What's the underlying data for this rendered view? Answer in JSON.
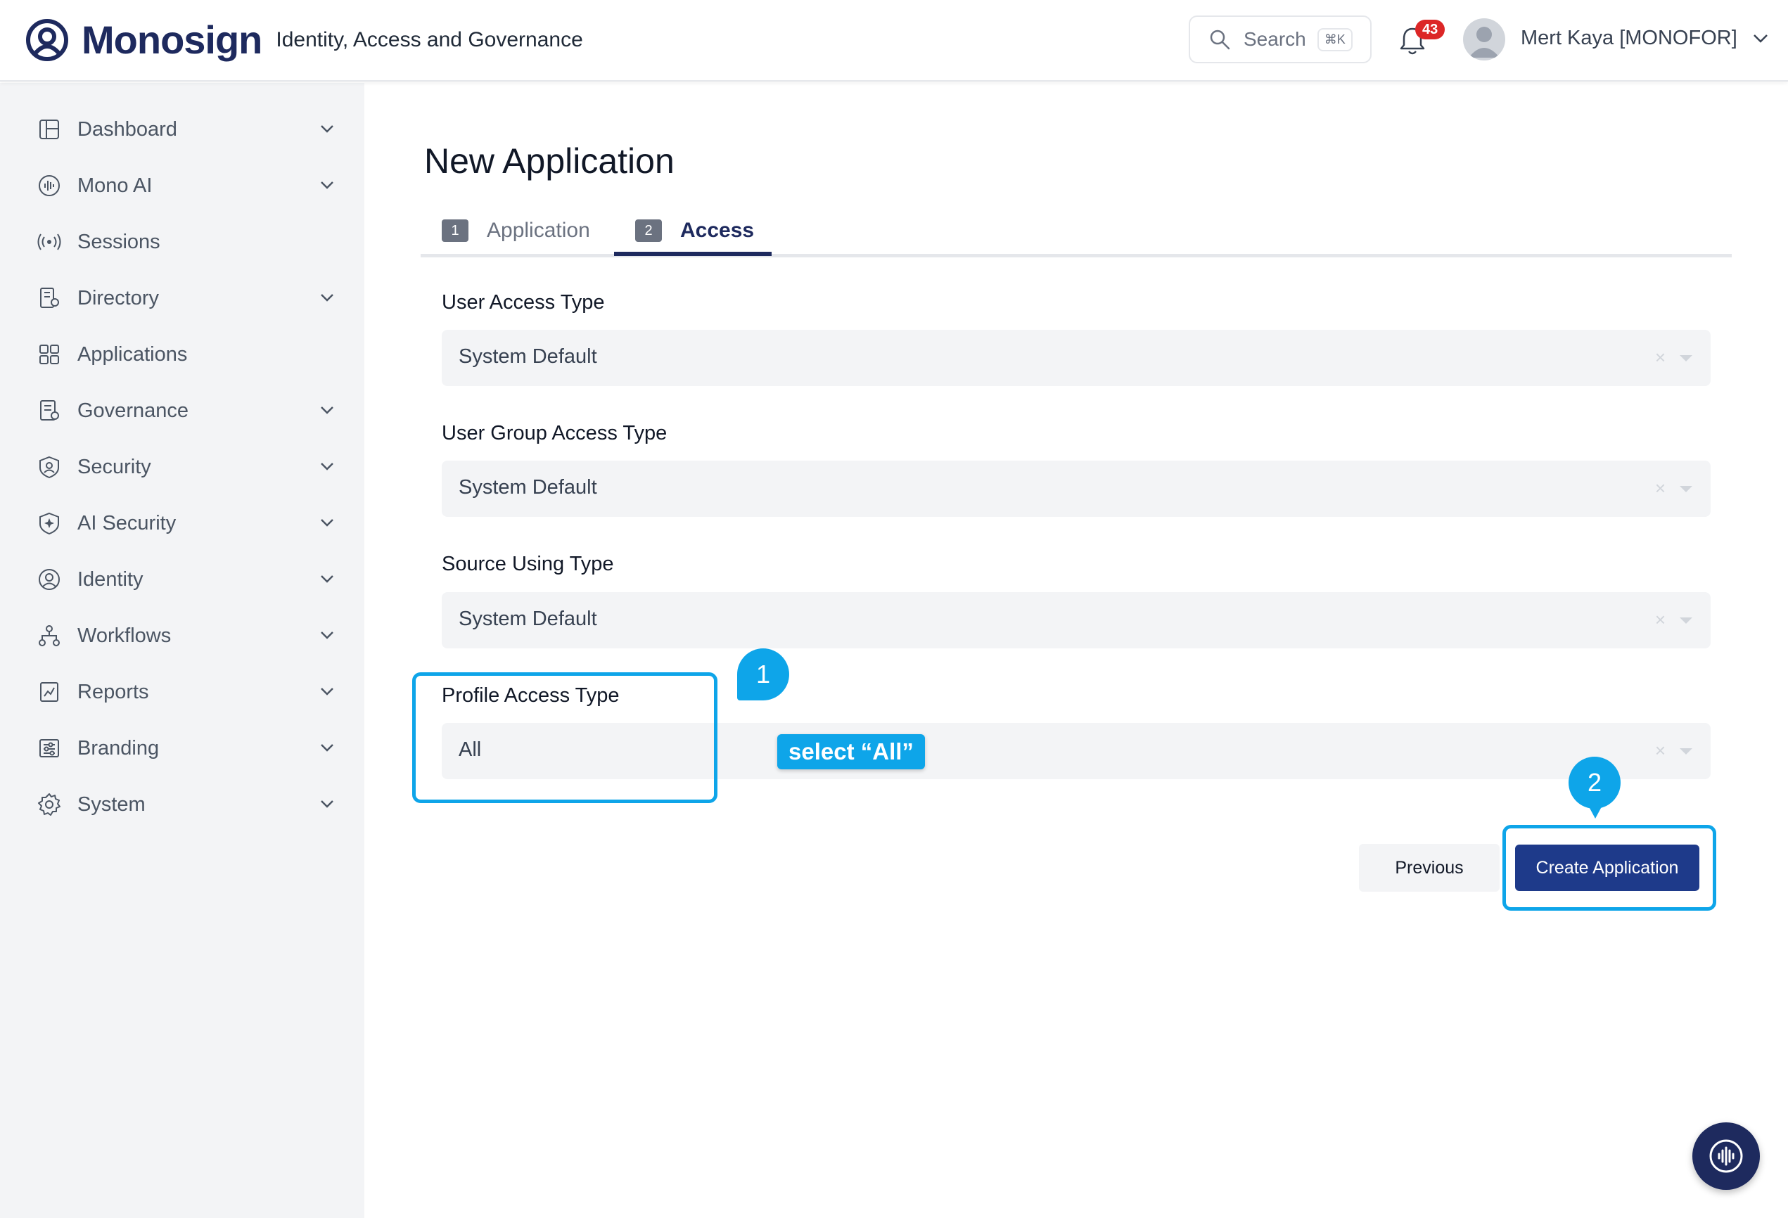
{
  "header": {
    "brand": "Monosign",
    "tagline": "Identity, Access and Governance",
    "search_label": "Search",
    "search_shortcut": "⌘K",
    "notification_count": "43",
    "user_name": "Mert Kaya [MONOFOR]"
  },
  "sidebar": {
    "items": [
      {
        "label": "Dashboard",
        "icon": "dashboard-icon",
        "expandable": true
      },
      {
        "label": "Mono AI",
        "icon": "mono-ai-icon",
        "expandable": true
      },
      {
        "label": "Sessions",
        "icon": "sessions-icon",
        "expandable": false
      },
      {
        "label": "Directory",
        "icon": "directory-icon",
        "expandable": true
      },
      {
        "label": "Applications",
        "icon": "applications-icon",
        "expandable": false
      },
      {
        "label": "Governance",
        "icon": "governance-icon",
        "expandable": true
      },
      {
        "label": "Security",
        "icon": "security-icon",
        "expandable": true
      },
      {
        "label": "AI Security",
        "icon": "ai-security-icon",
        "expandable": true
      },
      {
        "label": "Identity",
        "icon": "identity-icon",
        "expandable": true
      },
      {
        "label": "Workflows",
        "icon": "workflows-icon",
        "expandable": true
      },
      {
        "label": "Reports",
        "icon": "reports-icon",
        "expandable": true
      },
      {
        "label": "Branding",
        "icon": "branding-icon",
        "expandable": true
      },
      {
        "label": "System",
        "icon": "system-icon",
        "expandable": true
      }
    ]
  },
  "main": {
    "title": "New Application",
    "tabs": [
      {
        "number": "1",
        "label": "Application",
        "active": false
      },
      {
        "number": "2",
        "label": "Access",
        "active": true
      }
    ],
    "fields": [
      {
        "label": "User Access Type",
        "value": "System Default"
      },
      {
        "label": "User Group Access Type",
        "value": "System Default"
      },
      {
        "label": "Source Using Type",
        "value": "System Default"
      },
      {
        "label": "Profile Access Type",
        "value": "All"
      }
    ],
    "clear_glyph": "×",
    "previous_label": "Previous",
    "create_label": "Create Application"
  },
  "annotations": {
    "step1": "1",
    "step2": "2",
    "tip": "select “All”"
  },
  "colors": {
    "brand_navy": "#1e2a5e",
    "primary_button": "#1e3a8a",
    "annotation": "#0ea5e9",
    "badge": "#dc2626"
  }
}
